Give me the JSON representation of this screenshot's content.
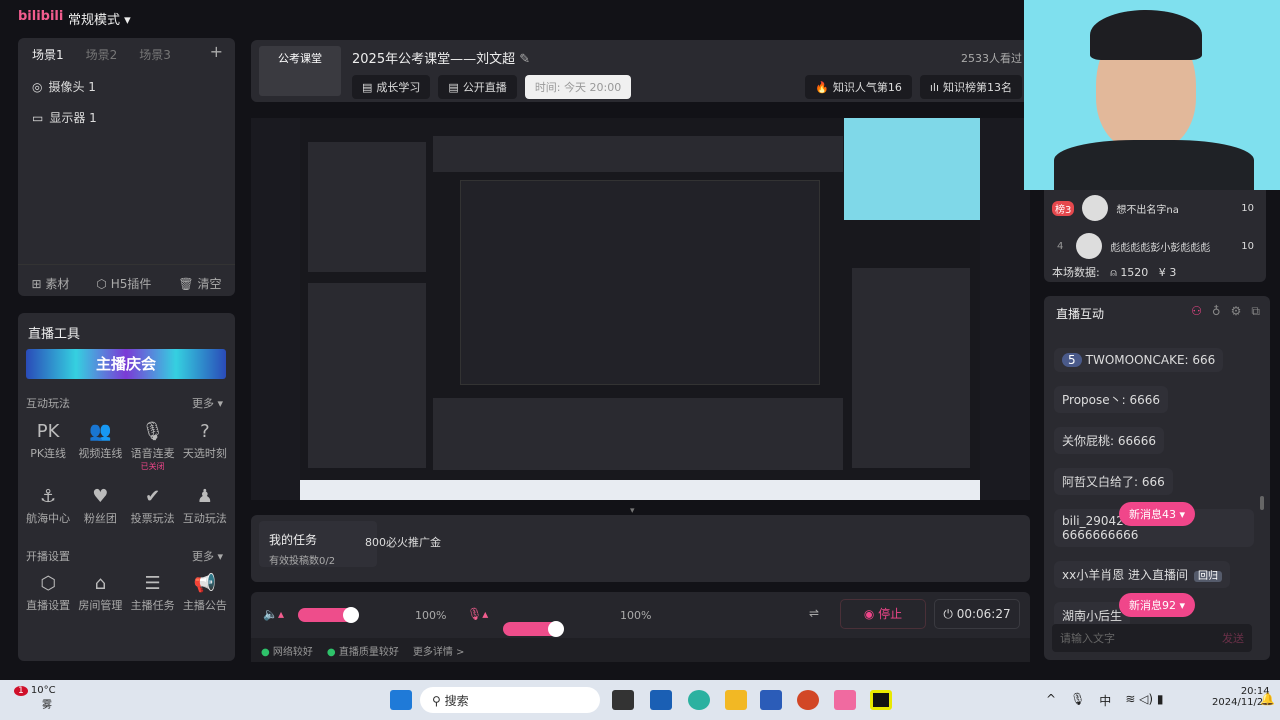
{
  "topbar": {
    "logo": "bilibili",
    "mode": "常规模式 ▾"
  },
  "scenes": {
    "tabs": [
      "场景1",
      "场景2",
      "场景3"
    ],
    "add": "+",
    "sources": [
      "摄像头 1",
      "显示器 1"
    ],
    "footer": [
      "素材",
      "H5插件",
      "清空"
    ]
  },
  "tools": {
    "title": "直播工具",
    "banner": "主播庆会",
    "section1": "互动玩法",
    "more": "更多 ▾",
    "items1": [
      {
        "icon": "PK",
        "label": "PK连线"
      },
      {
        "icon": "👥",
        "label": "视频连线"
      },
      {
        "icon": "🎙",
        "label": "语音连麦"
      },
      {
        "icon": "?",
        "label": "天选时刻"
      },
      {
        "icon": "⚓",
        "label": "航海中心"
      },
      {
        "icon": "♥",
        "label": "粉丝团"
      },
      {
        "icon": "✔",
        "label": "投票玩法"
      },
      {
        "icon": "♟",
        "label": "互动玩法"
      }
    ],
    "badge": "已关闭",
    "section2": "开播设置",
    "items2": [
      {
        "icon": "⬡",
        "label": "直播设置"
      },
      {
        "icon": "⌂",
        "label": "房间管理"
      },
      {
        "icon": "☰",
        "label": "主播任务"
      },
      {
        "icon": "📢",
        "label": "主播公告"
      }
    ]
  },
  "header": {
    "cover": "公考课堂",
    "title": "2025年公考课堂——刘文超",
    "viewers": "2533人看过",
    "tags": [
      "成长学习",
      "公开直播"
    ],
    "time": "时间: 今天 20:00",
    "rank1": "知识人气第16",
    "rank2": "知识榜第13名"
  },
  "task": {
    "title": "我的任务",
    "reward": "800必火推广金",
    "sub": "有效投稿数0/2"
  },
  "controls": {
    "speaker_pct": "100%",
    "mic_pct": "100%",
    "stop": "停止",
    "timer": "00:06:27",
    "speaker_level": 0.55,
    "mic_level": 0.55
  },
  "status": {
    "net": "网络较好",
    "quality": "直播质量较好",
    "more": "更多详情 >"
  },
  "rank": {
    "rows": [
      {
        "pos": "榜3",
        "name": "想不出名字na",
        "score": "10"
      },
      {
        "pos": "4",
        "name": "彪彪彪彪彭小彭彪彪彪",
        "score": "10"
      }
    ],
    "stats_label": "本场数据:",
    "viewers": "1520",
    "coins": "3"
  },
  "interact": {
    "title": "直播互动",
    "messages": [
      {
        "level": "5",
        "text": "TWOMOONCAKE: 666"
      },
      {
        "text": "Propose丶: 6666"
      },
      {
        "text": "关你屁桃: 66666"
      },
      {
        "text": "阿哲又白给了: 666"
      },
      {
        "text": "bili_29042970032: 6666666666"
      },
      {
        "text": "xx小羊肖恩 进入直播间",
        "tag": "回归"
      },
      {
        "text": "湖南小后生"
      }
    ],
    "new1": "新消息43 ▾",
    "new2": "新消息92 ▾",
    "placeholder": "请输入文字",
    "send": "发送"
  },
  "taskbar": {
    "weather_temp": "10°C",
    "weather_desc": "雾",
    "weather_badge": "1",
    "search": "搜索",
    "time": "20:14",
    "date": "2024/11/21",
    "ime": "中"
  },
  "colors": {
    "accent": "#f0468a",
    "panel": "#2a2a30",
    "bg": "#121217"
  }
}
